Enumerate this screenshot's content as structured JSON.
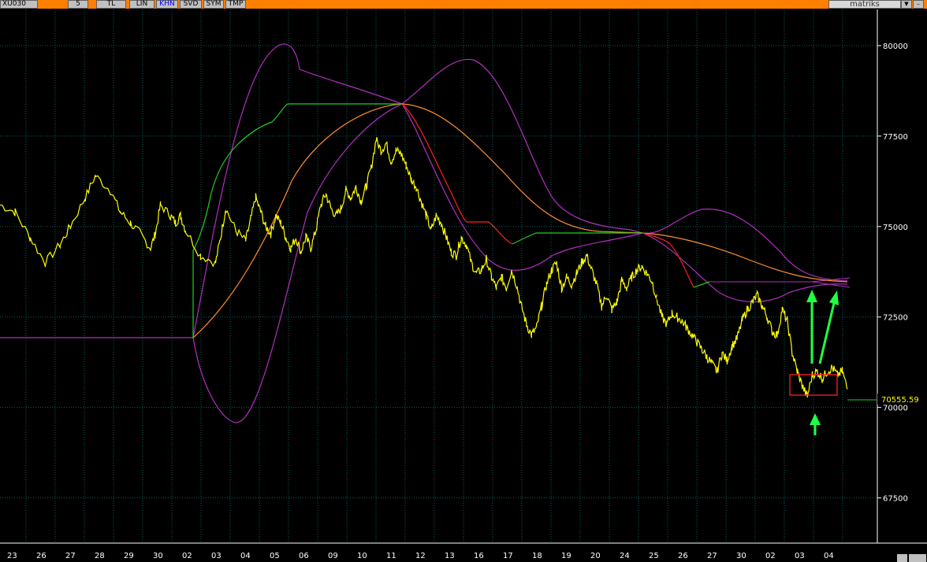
{
  "toolbar": {
    "symbol": "XU030",
    "period": "5",
    "currency": "TL",
    "scale": "LIN",
    "khn": "KHN",
    "svd": "SVD",
    "sym": "SYM",
    "tmp": "TMP",
    "brand": "matriks",
    "accent": "#ff7f00"
  },
  "chart_data": {
    "type": "line",
    "y_ticks": [
      "80000",
      "77500",
      "75000",
      "72500",
      "70000",
      "67500"
    ],
    "y_tick_values": [
      80000,
      77500,
      75000,
      72500,
      70000,
      67500
    ],
    "ylim": [
      66250,
      81000
    ],
    "x_ticks": [
      "23",
      "26",
      "27",
      "28",
      "29",
      "30",
      "02",
      "03",
      "04",
      "05",
      "06",
      "09",
      "10",
      "11",
      "12",
      "13",
      "16",
      "17",
      "18",
      "19",
      "20",
      "24",
      "25",
      "26",
      "27",
      "30",
      "02",
      "03",
      "04"
    ],
    "last_price_label": "70555.59",
    "last_price": 70555.59,
    "grid": true,
    "colors": {
      "price": "#ffff00",
      "upper_band": "#b030c0",
      "mid_orange": "#ff9030",
      "trend_green": "#20d020",
      "trend_red": "#ff2020",
      "annotation_arrow": "#20ff40",
      "annotation_box": "#ff2020",
      "grid": "#0f5f5f",
      "axis_text": "#ffffff"
    },
    "series": [
      {
        "key": "price",
        "values": [
          [
            0,
            75600
          ],
          [
            3,
            75400
          ],
          [
            6,
            74700
          ],
          [
            9,
            74000
          ],
          [
            12,
            74500
          ],
          [
            14,
            75000
          ],
          [
            17,
            75800
          ],
          [
            19,
            76400
          ],
          [
            22,
            76000
          ],
          [
            24,
            75400
          ],
          [
            26,
            75100
          ],
          [
            28,
            74800
          ],
          [
            30,
            74400
          ],
          [
            31,
            74800
          ],
          [
            32,
            75600
          ],
          [
            34,
            75300
          ],
          [
            35,
            75100
          ],
          [
            36,
            75300
          ],
          [
            37,
            74900
          ],
          [
            40,
            74200
          ],
          [
            43,
            74000
          ],
          [
            44,
            74700
          ],
          [
            45,
            75500
          ],
          [
            47,
            74900
          ],
          [
            49,
            74600
          ],
          [
            50,
            75200
          ],
          [
            51,
            75800
          ],
          [
            52,
            75400
          ],
          [
            53,
            75000
          ],
          [
            54,
            74800
          ],
          [
            55,
            75300
          ],
          [
            56,
            75100
          ],
          [
            57,
            74700
          ],
          [
            58,
            74400
          ],
          [
            59,
            74700
          ],
          [
            60,
            74300
          ],
          [
            61,
            74700
          ],
          [
            62,
            74400
          ],
          [
            63,
            74900
          ],
          [
            64,
            75600
          ],
          [
            65,
            75900
          ],
          [
            66,
            75500
          ],
          [
            67,
            75300
          ],
          [
            68,
            75500
          ],
          [
            69,
            76000
          ],
          [
            70,
            75800
          ],
          [
            71,
            76100
          ],
          [
            72,
            75700
          ],
          [
            73,
            76100
          ],
          [
            74,
            76600
          ],
          [
            75,
            77400
          ],
          [
            76,
            77100
          ],
          [
            77,
            77300
          ],
          [
            78,
            76800
          ],
          [
            79,
            77100
          ],
          [
            80,
            77000
          ],
          [
            81,
            76700
          ],
          [
            82,
            76300
          ],
          [
            83,
            76100
          ],
          [
            84,
            75700
          ],
          [
            85,
            75300
          ],
          [
            86,
            74900
          ],
          [
            87,
            75300
          ],
          [
            88,
            75100
          ],
          [
            89,
            74700
          ],
          [
            90,
            74300
          ],
          [
            91,
            74200
          ],
          [
            92,
            74700
          ],
          [
            93,
            74500
          ],
          [
            94,
            74000
          ],
          [
            95,
            73700
          ],
          [
            96,
            73800
          ],
          [
            97,
            74100
          ],
          [
            98,
            73600
          ],
          [
            99,
            73300
          ],
          [
            100,
            73600
          ],
          [
            101,
            73300
          ],
          [
            102,
            73800
          ],
          [
            103,
            73400
          ],
          [
            104,
            72800
          ],
          [
            105,
            72300
          ],
          [
            106,
            72000
          ],
          [
            107,
            72200
          ],
          [
            108,
            72800
          ],
          [
            109,
            73400
          ],
          [
            110,
            73800
          ],
          [
            111,
            74000
          ],
          [
            112,
            73300
          ],
          [
            113,
            73600
          ],
          [
            114,
            73400
          ],
          [
            115,
            73700
          ],
          [
            116,
            74000
          ],
          [
            117,
            74200
          ],
          [
            118,
            73800
          ],
          [
            119,
            73400
          ],
          [
            120,
            72800
          ],
          [
            121,
            73100
          ],
          [
            122,
            72700
          ],
          [
            123,
            72900
          ],
          [
            124,
            73500
          ],
          [
            125,
            73300
          ],
          [
            126,
            73600
          ],
          [
            127,
            73800
          ],
          [
            128,
            73900
          ],
          [
            129,
            73700
          ],
          [
            130,
            73500
          ],
          [
            131,
            73000
          ],
          [
            132,
            72500
          ],
          [
            133,
            72300
          ],
          [
            134,
            72600
          ],
          [
            135,
            72500
          ],
          [
            136,
            72400
          ],
          [
            137,
            72200
          ],
          [
            138,
            72000
          ],
          [
            139,
            71800
          ],
          [
            140,
            71600
          ],
          [
            141,
            71400
          ],
          [
            142,
            71200
          ],
          [
            143,
            71000
          ],
          [
            144,
            71500
          ],
          [
            145,
            71300
          ],
          [
            146,
            71700
          ],
          [
            147,
            71900
          ],
          [
            148,
            72400
          ],
          [
            149,
            72700
          ],
          [
            150,
            72900
          ],
          [
            151,
            73100
          ],
          [
            152,
            72800
          ],
          [
            153,
            72500
          ],
          [
            154,
            72100
          ],
          [
            155,
            72000
          ],
          [
            156,
            72700
          ],
          [
            157,
            72400
          ],
          [
            158,
            71500
          ],
          [
            159,
            71000
          ],
          [
            160,
            70600
          ],
          [
            161,
            70300
          ],
          [
            162,
            70900
          ],
          [
            163,
            71000
          ],
          [
            164,
            70800
          ],
          [
            165,
            71000
          ],
          [
            166,
            71100
          ],
          [
            167,
            70900
          ],
          [
            168,
            71000
          ],
          [
            169,
            70500
          ]
        ]
      }
    ],
    "annotations": [
      {
        "type": "box",
        "label": ""
      },
      {
        "type": "arrow",
        "label": ""
      },
      {
        "type": "arrow",
        "label": ""
      },
      {
        "type": "arrow",
        "label": ""
      }
    ]
  }
}
